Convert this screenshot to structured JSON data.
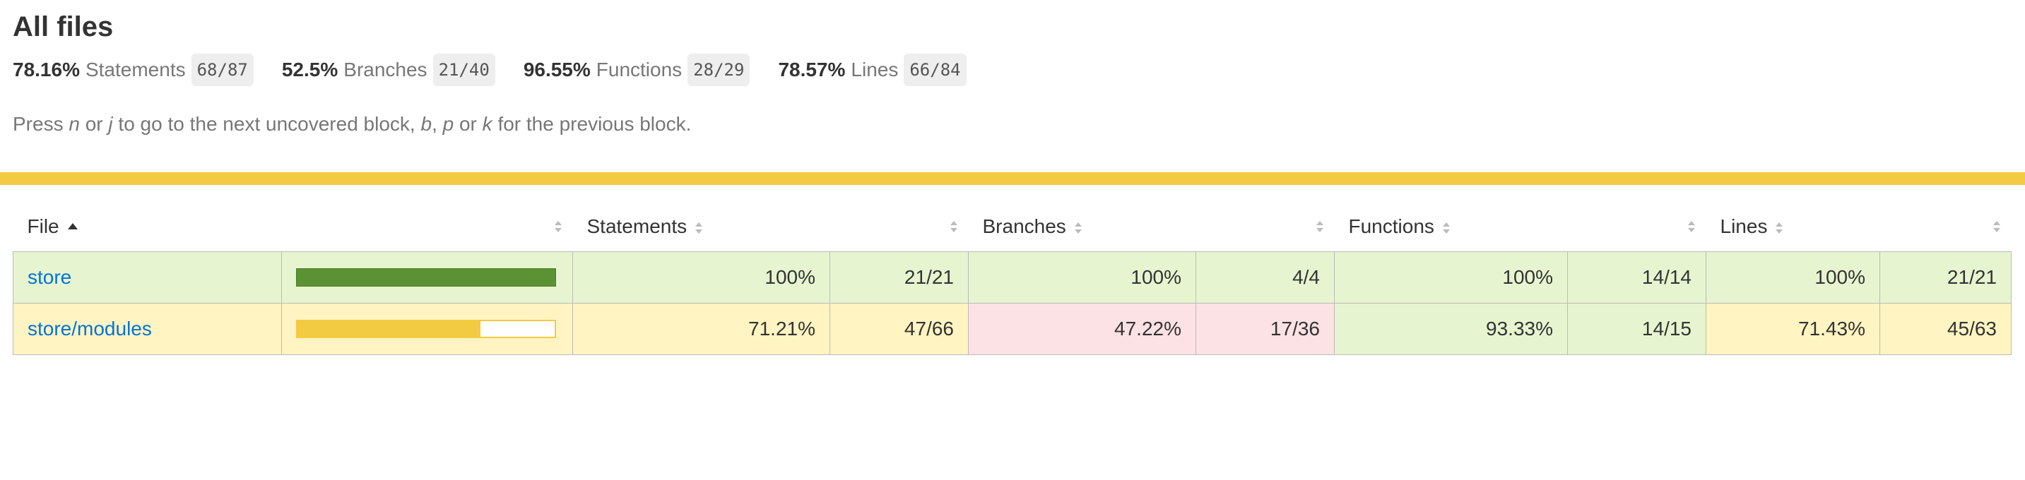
{
  "title": "All files",
  "summary": [
    {
      "pct": "78.16%",
      "label": "Statements",
      "fraction": "68/87"
    },
    {
      "pct": "52.5%",
      "label": "Branches",
      "fraction": "21/40"
    },
    {
      "pct": "96.55%",
      "label": "Functions",
      "fraction": "28/29"
    },
    {
      "pct": "78.57%",
      "label": "Lines",
      "fraction": "66/84"
    }
  ],
  "hint": {
    "press": "Press ",
    "key_n": "n",
    "or1": " or ",
    "key_j": "j",
    "next": " to go to the next uncovered block, ",
    "key_b": "b",
    "comma": ", ",
    "key_p": "p",
    "or2": " or ",
    "key_k": "k",
    "prev": " for the previous block."
  },
  "colors": {
    "status_bar": "#f3cb42",
    "high": "#e6f5d0",
    "medium": "#fff4c2",
    "low": "#fce1e5",
    "link": "#0074d9"
  },
  "table": {
    "headers": {
      "file": "File",
      "statements": "Statements",
      "branches": "Branches",
      "functions": "Functions",
      "lines": "Lines"
    },
    "rows": [
      {
        "file": "store",
        "coverage_fraction": 1.0,
        "statements_pct": "100%",
        "statements_frac": "21/21",
        "branches_pct": "100%",
        "branches_frac": "4/4",
        "functions_pct": "100%",
        "functions_frac": "14/14",
        "lines_pct": "100%",
        "lines_frac": "21/21"
      },
      {
        "file": "store/modules",
        "coverage_fraction": 0.7121,
        "statements_pct": "71.21%",
        "statements_frac": "47/66",
        "branches_pct": "47.22%",
        "branches_frac": "17/36",
        "functions_pct": "93.33%",
        "functions_frac": "14/15",
        "lines_pct": "71.43%",
        "lines_frac": "45/63"
      }
    ]
  }
}
